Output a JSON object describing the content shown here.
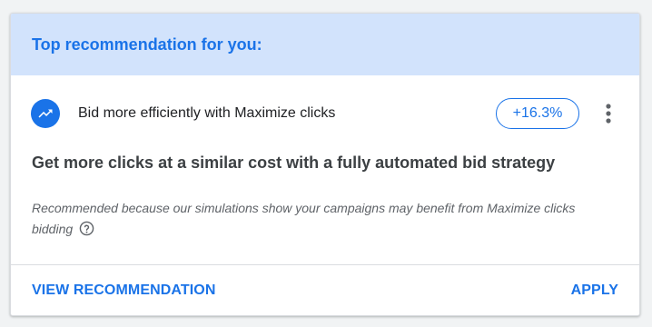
{
  "card": {
    "header_title": "Top recommendation for you:",
    "recommendation": {
      "icon": "trending-up-icon",
      "title": "Bid more efficiently with Maximize clicks",
      "uplift": "+16.3%",
      "menu_icon": "more-vert-icon"
    },
    "headline": "Get more clicks at a similar cost with a fully automated bid strategy",
    "reason_text": "Recommended because our simulations show your campaigns may benefit from Maximize clicks bidding",
    "help_icon": "help-circle-icon",
    "actions": {
      "view_label": "VIEW RECOMMENDATION",
      "apply_label": "APPLY"
    }
  },
  "colors": {
    "accent": "#1a73e8",
    "header_bg": "#d2e3fc",
    "text_primary": "#202124",
    "text_secondary": "#5f6368"
  }
}
